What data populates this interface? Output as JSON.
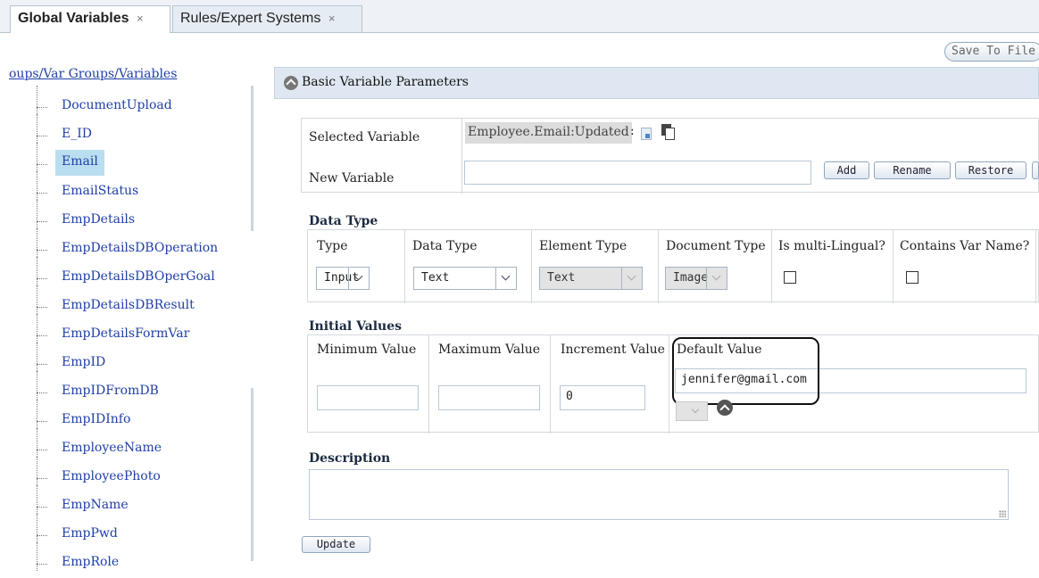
{
  "tabs": [
    {
      "label": "Global Variables",
      "close": "×",
      "active": true
    },
    {
      "label": "Rules/Expert Systems",
      "close": "×",
      "active": false
    }
  ],
  "toolbar": {
    "save_label": "Save To File"
  },
  "tree": {
    "header": "oups/Var Groups/Variables",
    "selected": "Email",
    "items": [
      "DocumentUpload",
      "E_ID",
      "Email",
      "EmailStatus",
      "EmpDetails",
      "EmpDetailsDBOperation",
      "EmpDetailsDBOperGoal",
      "EmpDetailsDBResult",
      "EmpDetailsFormVar",
      "EmpID",
      "EmpIDFromDB",
      "EmpIDInfo",
      "EmployeeName",
      "EmployeePhoto",
      "EmpName",
      "EmpPwd",
      "EmpRole"
    ]
  },
  "panel": {
    "title": "Basic Variable Parameters"
  },
  "selected_variable": {
    "label": "Selected Variable",
    "value": "Employee.Email:Updated",
    "colon": ":",
    "new_label": "New Variable",
    "new_value": "",
    "buttons": {
      "add": "Add",
      "rename": "Rename",
      "restore": "Restore"
    }
  },
  "data_type": {
    "title": "Data Type",
    "columns": {
      "type": {
        "header": "Type",
        "value": "Input"
      },
      "data_type": {
        "header": "Data Type",
        "value": "Text"
      },
      "element_type": {
        "header": "Element Type",
        "value": "Text"
      },
      "document_type": {
        "header": "Document Type",
        "value": "Image"
      },
      "multi_lingual": {
        "header": "Is multi-Lingual?",
        "checked": false
      },
      "contains_var": {
        "header": "Contains Var Name?",
        "checked": false
      }
    }
  },
  "initial_values": {
    "title": "Initial Values",
    "min": {
      "header": "Minimum Value",
      "value": ""
    },
    "max": {
      "header": "Maximum Value",
      "value": ""
    },
    "increment": {
      "header": "Increment Value",
      "value": "0"
    },
    "default": {
      "header": "Default Value",
      "value": "jennifer@gmail.com"
    }
  },
  "description": {
    "title": "Description",
    "value": ""
  },
  "update_label": "Update",
  "icons": [
    "close-icon",
    "collapse-icon",
    "document-icon",
    "copy-icon",
    "chevron-down-icon",
    "move-up-icon"
  ]
}
